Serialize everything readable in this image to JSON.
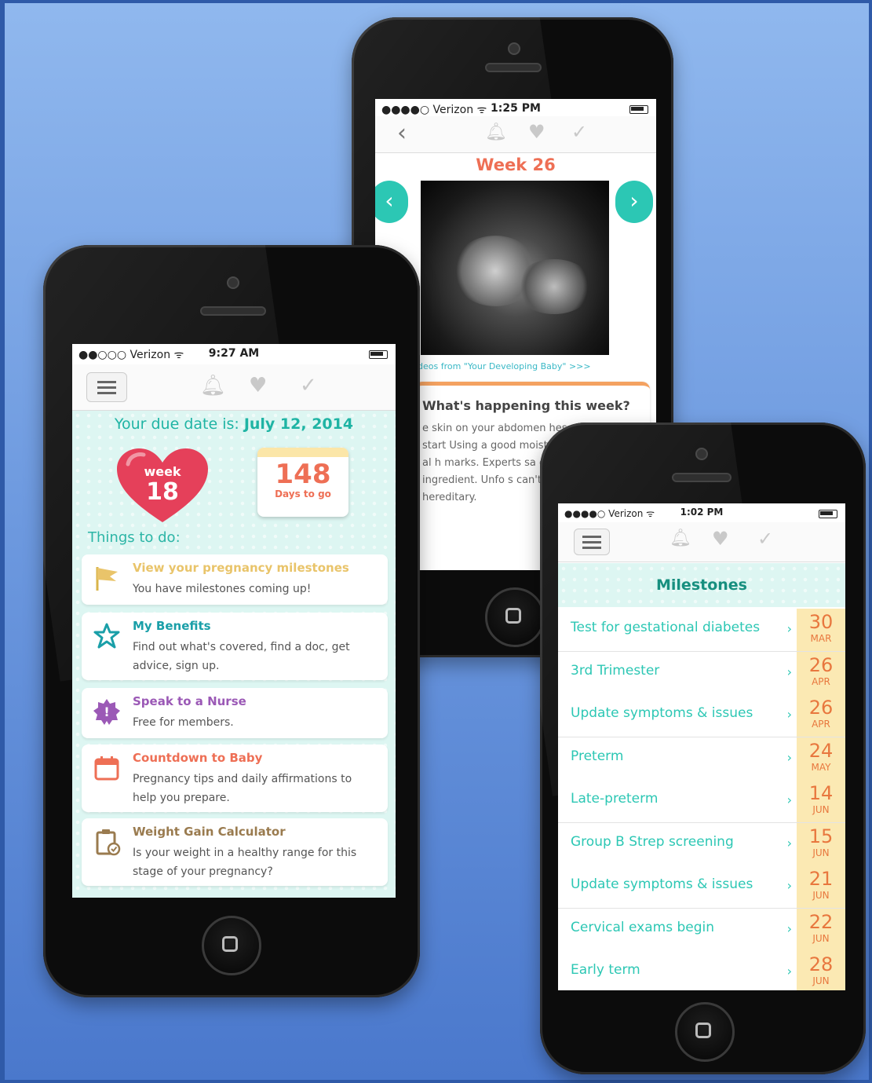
{
  "phone1": {
    "status": {
      "carrier": "●●○○○ Verizon ᯤ",
      "time": "9:27 AM"
    },
    "due_label": "Your due date is: ",
    "due_date": "July 12, 2014",
    "week_label": "week",
    "week_number": "18",
    "days_number": "148",
    "days_label": "Days to go",
    "things_heading": "Things to do:",
    "cards": [
      {
        "title": "View your pregnancy milestones",
        "desc": "You have milestones coming up!",
        "color": "#e9c46a",
        "icon": "flag-icon"
      },
      {
        "title": "My Benefits",
        "desc": "Find out what's covered, find a doc, get advice, sign up.",
        "color": "#1a9fa8",
        "icon": "star-icon"
      },
      {
        "title": "Speak to a Nurse",
        "desc": "Free for members.",
        "color": "#9b59b6",
        "icon": "badge-icon"
      },
      {
        "title": "Countdown to Baby",
        "desc": "Pregnancy tips and daily affirmations to help you prepare.",
        "color": "#ee6f55",
        "icon": "calendar-icon"
      },
      {
        "title": "Weight Gain Calculator",
        "desc": "Is your weight in a healthy range for this stage of your pregnancy?",
        "color": "#9a7b4f",
        "icon": "clipboard-icon"
      }
    ]
  },
  "phone2": {
    "status": {
      "carrier": "●●●●○ Verizon ᯤ",
      "time": "1:25 PM"
    },
    "week_title": "Week 26",
    "caption": "deos from \"Your Developing Baby\" >>>",
    "happening_title": "What's happening this week?",
    "happening_text": "e skin on your abdomen hes out, it may start Using a good moist help. Lotion may al h marks. Experts sa contains cocoa or s ingredient. Unfo s can't always be to be hereditary."
  },
  "phone3": {
    "status": {
      "carrier": "●●●●○ Verizon ᯤ",
      "time": "1:02 PM"
    },
    "title": "Milestones",
    "items": [
      {
        "label": "Test for gestational diabetes",
        "day": "30",
        "month": "MAR"
      },
      {
        "label": "3rd Trimester",
        "day": "26",
        "month": "APR"
      },
      {
        "label": "Update symptoms & issues",
        "day": "26",
        "month": "APR"
      },
      {
        "label": "Preterm",
        "day": "24",
        "month": "MAY"
      },
      {
        "label": "Late-preterm",
        "day": "14",
        "month": "JUN"
      },
      {
        "label": "Group B Strep screening",
        "day": "15",
        "month": "JUN"
      },
      {
        "label": "Update symptoms & issues",
        "day": "21",
        "month": "JUN"
      },
      {
        "label": "Cervical exams begin",
        "day": "22",
        "month": "JUN"
      },
      {
        "label": "Early term",
        "day": "28",
        "month": "JUN"
      }
    ]
  },
  "colors": {
    "teal": "#2cc7b4",
    "coral": "#ee6f55",
    "heart": "#e5405a",
    "date_bg": "#fbe9b3"
  }
}
